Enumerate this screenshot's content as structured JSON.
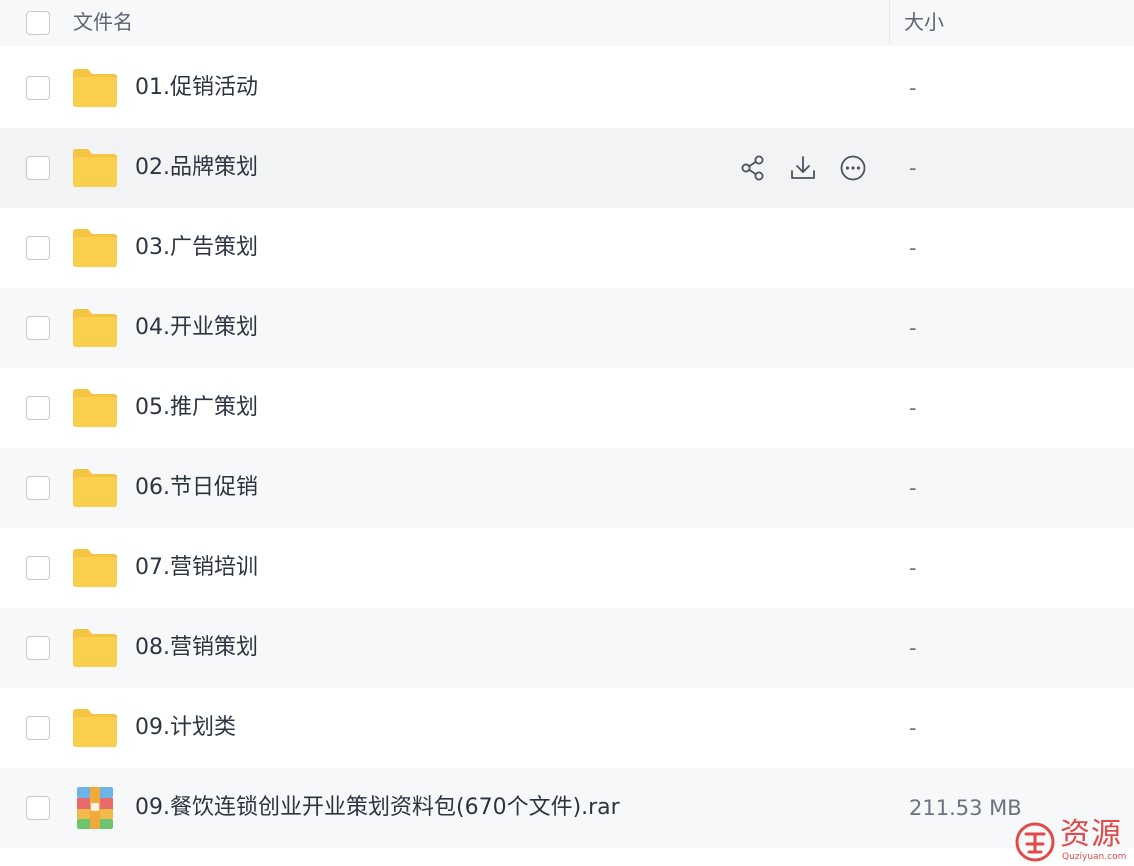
{
  "header": {
    "name_label": "文件名",
    "size_label": "大小"
  },
  "files": [
    {
      "name": "01.促销活动",
      "size": "-",
      "type": "folder-icon"
    },
    {
      "name": "02.品牌策划",
      "size": "-",
      "type": "folder-icon"
    },
    {
      "name": "03.广告策划",
      "size": "-",
      "type": "folder-icon"
    },
    {
      "name": "04.开业策划",
      "size": "-",
      "type": "folder-icon"
    },
    {
      "name": "05.推广策划",
      "size": "-",
      "type": "folder-icon"
    },
    {
      "name": "06.节日促销",
      "size": "-",
      "type": "folder-icon"
    },
    {
      "name": "07.营销培训",
      "size": "-",
      "type": "folder-icon"
    },
    {
      "name": "08.营销策划",
      "size": "-",
      "type": "folder-icon"
    },
    {
      "name": "09.计划类",
      "size": "-",
      "type": "folder-icon"
    },
    {
      "name": "09.餐饮连锁创业开业策划资料包(670个文件).rar",
      "size": "211.53 MB",
      "type": "archive-icon"
    }
  ],
  "hovered_row_actions": [
    "share-icon",
    "download-icon",
    "more-icon"
  ],
  "watermark": {
    "text": "资源",
    "url": "Quziyuan.com"
  },
  "colors": {
    "folder": "#f9cf4d",
    "folder_tab": "#f5c542",
    "watermark": "#e14a4a"
  }
}
